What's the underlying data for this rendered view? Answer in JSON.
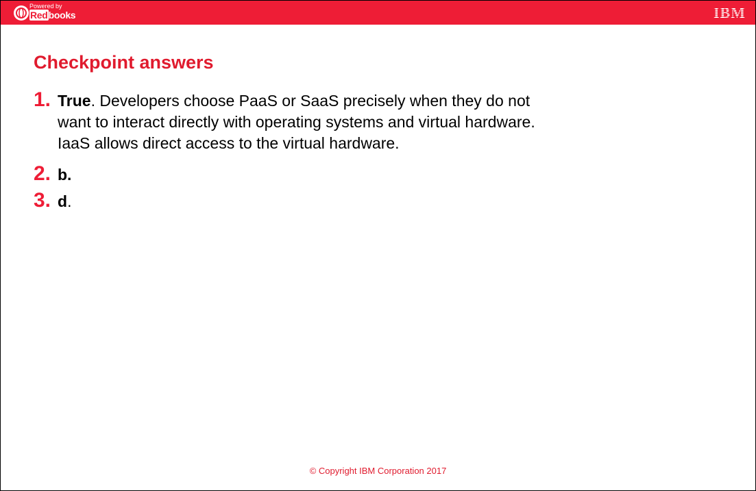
{
  "header": {
    "logo_powered": "Powered by",
    "logo_brand_red": "Red",
    "logo_brand_white": "books",
    "ibm_logo": "IBM",
    "colors": {
      "banner": "#ee1d36",
      "accent": "#e01b2e"
    }
  },
  "slide": {
    "title": "Checkpoint answers",
    "items": [
      {
        "number": "1.",
        "bold": "True",
        "line1": ". Developers choose PaaS or SaaS precisely when they do not",
        "line2": "want to interact directly with operating systems and virtual hardware.",
        "line3": "IaaS allows direct access to the virtual hardware."
      },
      {
        "number": "2.",
        "bold": "b.",
        "rest": ""
      },
      {
        "number": "3.",
        "bold": "d",
        "rest": "."
      }
    ]
  },
  "footer": {
    "copyright": "© Copyright IBM Corporation 2017"
  }
}
